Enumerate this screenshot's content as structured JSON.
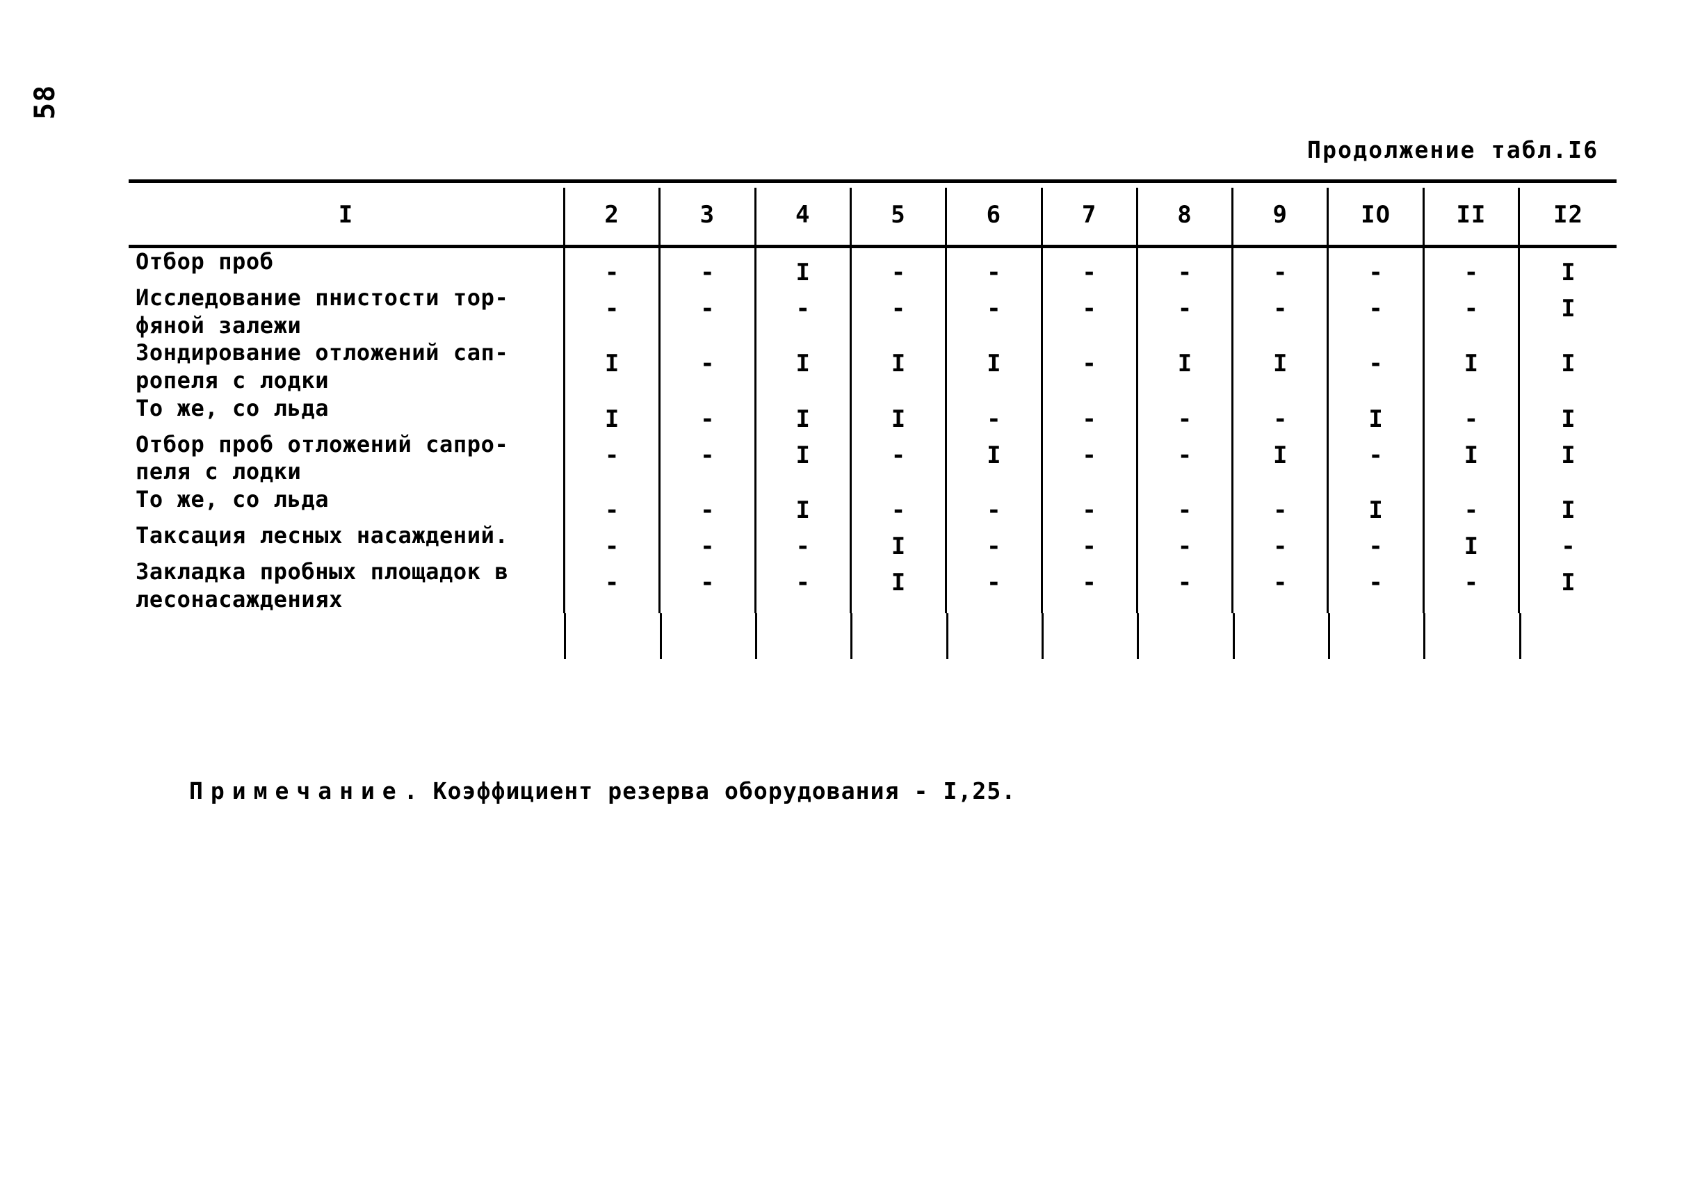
{
  "page": {
    "number": "58",
    "caption": "Продолжение табл.I6"
  },
  "table": {
    "columns": [
      "I",
      "2",
      "3",
      "4",
      "5",
      "6",
      "7",
      "8",
      "9",
      "IO",
      "II",
      "I2"
    ],
    "rows": [
      {
        "label": "Отбор проб",
        "values": [
          "-",
          "-",
          "I",
          "-",
          "-",
          "-",
          "-",
          "-",
          "-",
          "-",
          "I"
        ]
      },
      {
        "label": "Исследование пнистости тор-\nфяной залежи",
        "values": [
          "-",
          "-",
          "-",
          "-",
          "-",
          "-",
          "-",
          "-",
          "-",
          "-",
          "I"
        ]
      },
      {
        "label": "Зондирование отложений сап-\nропеля с лодки",
        "values": [
          "I",
          "-",
          "I",
          "I",
          "I",
          "-",
          "I",
          "I",
          "-",
          "I",
          "I"
        ]
      },
      {
        "label": "То же, со льда",
        "values": [
          "I",
          "-",
          "I",
          "I",
          "-",
          "-",
          "-",
          "-",
          "I",
          "-",
          "I"
        ]
      },
      {
        "label": "Отбор проб отложений сапро-\nпеля с лодки",
        "values": [
          "-",
          "-",
          "I",
          "-",
          "I",
          "-",
          "-",
          "I",
          "-",
          "I",
          "I"
        ]
      },
      {
        "label": "То же, со льда",
        "values": [
          "-",
          "-",
          "I",
          "-",
          "-",
          "-",
          "-",
          "-",
          "I",
          "-",
          "I"
        ]
      },
      {
        "label": "Таксация лесных насаждений.",
        "values": [
          "-",
          "-",
          "-",
          "I",
          "-",
          "-",
          "-",
          "-",
          "-",
          "I",
          "-"
        ]
      },
      {
        "label": "Закладка пробных площадок в\nлесонасаждениях",
        "values": [
          "-",
          "-",
          "-",
          "I",
          "-",
          "-",
          "-",
          "-",
          "-",
          "-",
          "I"
        ]
      }
    ]
  },
  "note": {
    "label": "Примечание",
    "text": ". Коэффициент резерва оборудования - I,25."
  }
}
